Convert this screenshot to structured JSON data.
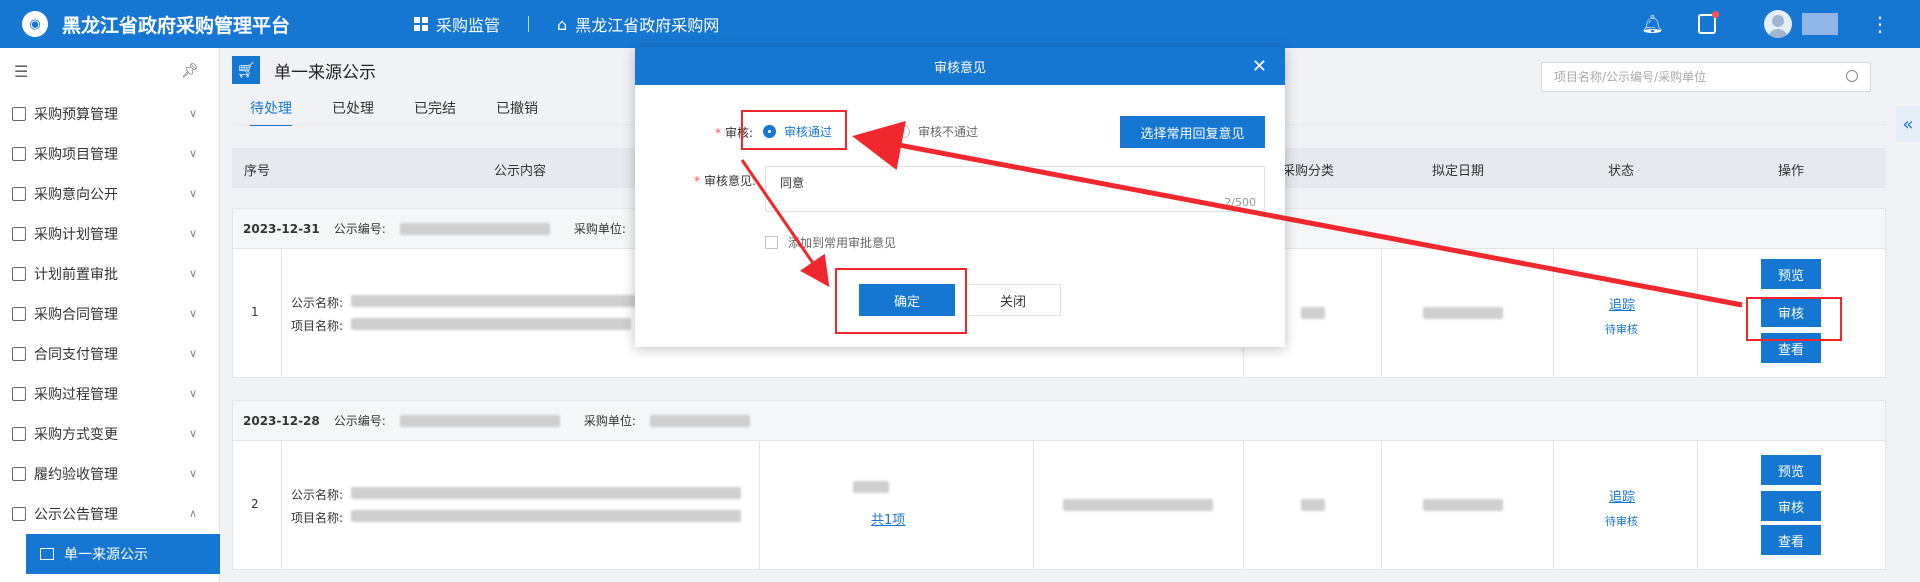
{
  "header": {
    "app_title": "黑龙江省政府采购管理平台",
    "nav": [
      {
        "label": "采购监管",
        "icon": "grid-icon"
      },
      {
        "label": "黑龙江省政府采购网",
        "icon": "home-icon"
      }
    ],
    "icons": [
      "bell-icon",
      "task-icon",
      "avatar",
      "more-icon"
    ]
  },
  "sidebar": {
    "items": [
      {
        "label": "采购预算管理",
        "expanded": false
      },
      {
        "label": "采购项目管理",
        "expanded": false
      },
      {
        "label": "采购意向公开",
        "expanded": false
      },
      {
        "label": "采购计划管理",
        "expanded": false
      },
      {
        "label": "计划前置审批",
        "expanded": false
      },
      {
        "label": "采购合同管理",
        "expanded": false
      },
      {
        "label": "合同支付管理",
        "expanded": false
      },
      {
        "label": "采购过程管理",
        "expanded": false
      },
      {
        "label": "采购方式变更",
        "expanded": false
      },
      {
        "label": "履约验收管理",
        "expanded": false
      },
      {
        "label": "公示公告管理",
        "expanded": true
      }
    ],
    "active_sub": "单一来源公示"
  },
  "page": {
    "title": "单一来源公示",
    "search_placeholder": "项目名称/公示编号/采购单位",
    "tabs": [
      "待处理",
      "已处理",
      "已完结",
      "已撤销"
    ],
    "active_tab": 0
  },
  "table": {
    "headers": {
      "no": "序号",
      "content": "公示内容",
      "category": "采购分类",
      "date": "拟定日期",
      "status": "状态",
      "ops": "操作"
    },
    "group_labels": {
      "code": "公示编号:",
      "unit": "采购单位:",
      "name": "公示名称:",
      "project": "项目名称:"
    },
    "groups": [
      {
        "date": "2023-12-31",
        "no": "1",
        "track": "追踪",
        "status": "待审核",
        "attach": ""
      },
      {
        "date": "2023-12-28",
        "no": "2",
        "track": "追踪",
        "status": "待审核",
        "attach": "共1项"
      }
    ],
    "actions": {
      "preview": "预览",
      "review": "审核",
      "view": "查看"
    }
  },
  "modal": {
    "title": "审核意见",
    "result_label": "审核:",
    "pass": "审核通过",
    "fail": "审核不通过",
    "selected": "pass",
    "choose_btn": "选择常用回复意见",
    "opinion_label": "审核意见:",
    "opinion_value": "同意",
    "counter": "2/500",
    "checkbox_label": "添加到常用审批意见",
    "ok": "确定",
    "close": "关闭"
  },
  "colors": {
    "primary": "#1677d2",
    "annotation_red": "#f0282d"
  }
}
